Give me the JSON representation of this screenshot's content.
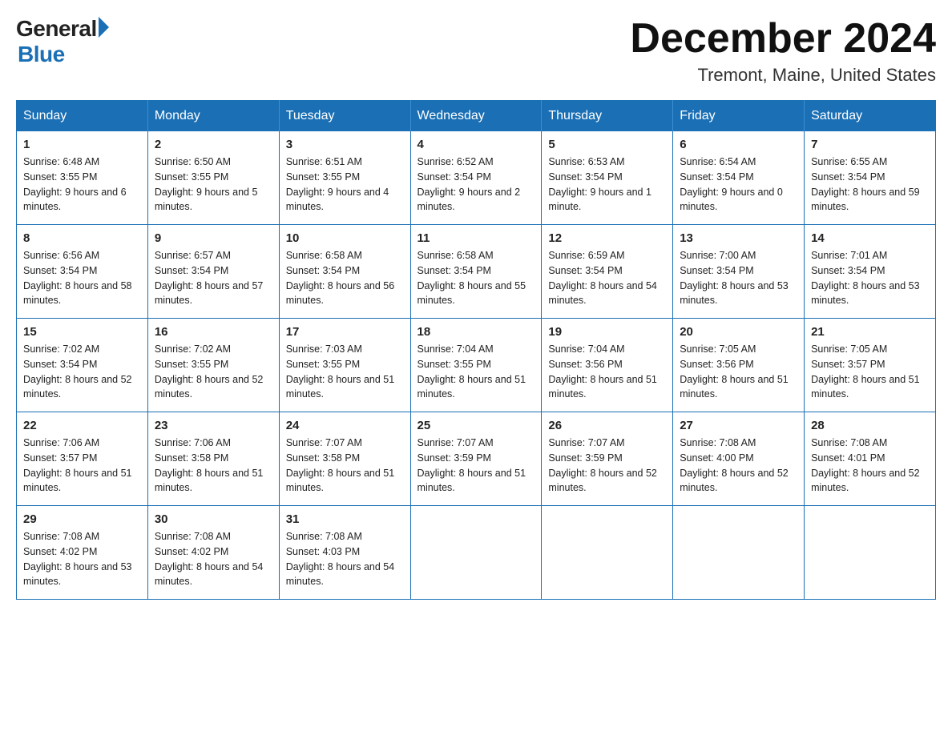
{
  "header": {
    "logo_general": "General",
    "logo_blue": "Blue",
    "title": "December 2024",
    "subtitle": "Tremont, Maine, United States"
  },
  "weekdays": [
    "Sunday",
    "Monday",
    "Tuesday",
    "Wednesday",
    "Thursday",
    "Friday",
    "Saturday"
  ],
  "weeks": [
    [
      {
        "day": "1",
        "sunrise": "6:48 AM",
        "sunset": "3:55 PM",
        "daylight": "9 hours and 6 minutes."
      },
      {
        "day": "2",
        "sunrise": "6:50 AM",
        "sunset": "3:55 PM",
        "daylight": "9 hours and 5 minutes."
      },
      {
        "day": "3",
        "sunrise": "6:51 AM",
        "sunset": "3:55 PM",
        "daylight": "9 hours and 4 minutes."
      },
      {
        "day": "4",
        "sunrise": "6:52 AM",
        "sunset": "3:54 PM",
        "daylight": "9 hours and 2 minutes."
      },
      {
        "day": "5",
        "sunrise": "6:53 AM",
        "sunset": "3:54 PM",
        "daylight": "9 hours and 1 minute."
      },
      {
        "day": "6",
        "sunrise": "6:54 AM",
        "sunset": "3:54 PM",
        "daylight": "9 hours and 0 minutes."
      },
      {
        "day": "7",
        "sunrise": "6:55 AM",
        "sunset": "3:54 PM",
        "daylight": "8 hours and 59 minutes."
      }
    ],
    [
      {
        "day": "8",
        "sunrise": "6:56 AM",
        "sunset": "3:54 PM",
        "daylight": "8 hours and 58 minutes."
      },
      {
        "day": "9",
        "sunrise": "6:57 AM",
        "sunset": "3:54 PM",
        "daylight": "8 hours and 57 minutes."
      },
      {
        "day": "10",
        "sunrise": "6:58 AM",
        "sunset": "3:54 PM",
        "daylight": "8 hours and 56 minutes."
      },
      {
        "day": "11",
        "sunrise": "6:58 AM",
        "sunset": "3:54 PM",
        "daylight": "8 hours and 55 minutes."
      },
      {
        "day": "12",
        "sunrise": "6:59 AM",
        "sunset": "3:54 PM",
        "daylight": "8 hours and 54 minutes."
      },
      {
        "day": "13",
        "sunrise": "7:00 AM",
        "sunset": "3:54 PM",
        "daylight": "8 hours and 53 minutes."
      },
      {
        "day": "14",
        "sunrise": "7:01 AM",
        "sunset": "3:54 PM",
        "daylight": "8 hours and 53 minutes."
      }
    ],
    [
      {
        "day": "15",
        "sunrise": "7:02 AM",
        "sunset": "3:54 PM",
        "daylight": "8 hours and 52 minutes."
      },
      {
        "day": "16",
        "sunrise": "7:02 AM",
        "sunset": "3:55 PM",
        "daylight": "8 hours and 52 minutes."
      },
      {
        "day": "17",
        "sunrise": "7:03 AM",
        "sunset": "3:55 PM",
        "daylight": "8 hours and 51 minutes."
      },
      {
        "day": "18",
        "sunrise": "7:04 AM",
        "sunset": "3:55 PM",
        "daylight": "8 hours and 51 minutes."
      },
      {
        "day": "19",
        "sunrise": "7:04 AM",
        "sunset": "3:56 PM",
        "daylight": "8 hours and 51 minutes."
      },
      {
        "day": "20",
        "sunrise": "7:05 AM",
        "sunset": "3:56 PM",
        "daylight": "8 hours and 51 minutes."
      },
      {
        "day": "21",
        "sunrise": "7:05 AM",
        "sunset": "3:57 PM",
        "daylight": "8 hours and 51 minutes."
      }
    ],
    [
      {
        "day": "22",
        "sunrise": "7:06 AM",
        "sunset": "3:57 PM",
        "daylight": "8 hours and 51 minutes."
      },
      {
        "day": "23",
        "sunrise": "7:06 AM",
        "sunset": "3:58 PM",
        "daylight": "8 hours and 51 minutes."
      },
      {
        "day": "24",
        "sunrise": "7:07 AM",
        "sunset": "3:58 PM",
        "daylight": "8 hours and 51 minutes."
      },
      {
        "day": "25",
        "sunrise": "7:07 AM",
        "sunset": "3:59 PM",
        "daylight": "8 hours and 51 minutes."
      },
      {
        "day": "26",
        "sunrise": "7:07 AM",
        "sunset": "3:59 PM",
        "daylight": "8 hours and 52 minutes."
      },
      {
        "day": "27",
        "sunrise": "7:08 AM",
        "sunset": "4:00 PM",
        "daylight": "8 hours and 52 minutes."
      },
      {
        "day": "28",
        "sunrise": "7:08 AM",
        "sunset": "4:01 PM",
        "daylight": "8 hours and 52 minutes."
      }
    ],
    [
      {
        "day": "29",
        "sunrise": "7:08 AM",
        "sunset": "4:02 PM",
        "daylight": "8 hours and 53 minutes."
      },
      {
        "day": "30",
        "sunrise": "7:08 AM",
        "sunset": "4:02 PM",
        "daylight": "8 hours and 54 minutes."
      },
      {
        "day": "31",
        "sunrise": "7:08 AM",
        "sunset": "4:03 PM",
        "daylight": "8 hours and 54 minutes."
      },
      null,
      null,
      null,
      null
    ]
  ],
  "labels": {
    "sunrise": "Sunrise:",
    "sunset": "Sunset:",
    "daylight": "Daylight:"
  }
}
